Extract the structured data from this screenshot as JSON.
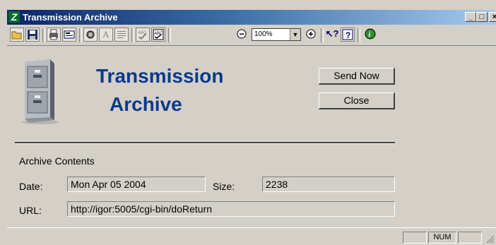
{
  "window": {
    "title": "Transmission Archive",
    "app_icon_letter": "Z"
  },
  "window_controls": {
    "minimize": "_",
    "maximize": "□",
    "close": "×"
  },
  "toolbar": {
    "zoom_value": "100%",
    "icons": [
      "open-folder-icon",
      "save-icon",
      "print-icon",
      "form-icon",
      "settings-icon",
      "font-icon",
      "paragraph-icon",
      "spellcheck-icon",
      "thesaurus-icon",
      "zoom-out-icon",
      "zoom-in-icon",
      "whats-this-icon",
      "help-icon",
      "info-icon"
    ]
  },
  "header": {
    "title_line1": "Transmission",
    "title_line2": "Archive"
  },
  "buttons": {
    "send_now": "Send Now",
    "close": "Close"
  },
  "archive": {
    "section_label": "Archive Contents",
    "date_label": "Date:",
    "date_value": "Mon Apr 05 2004",
    "size_label": "Size:",
    "size_value": "2238",
    "url_label": "URL:",
    "url_value": "http://igor:5005/cgi-bin/doReturn"
  },
  "statusbar": {
    "num": "NUM"
  },
  "colors": {
    "heading": "#0b3a8a",
    "titlebar": "#0a246a",
    "face": "#d4d0c8"
  }
}
